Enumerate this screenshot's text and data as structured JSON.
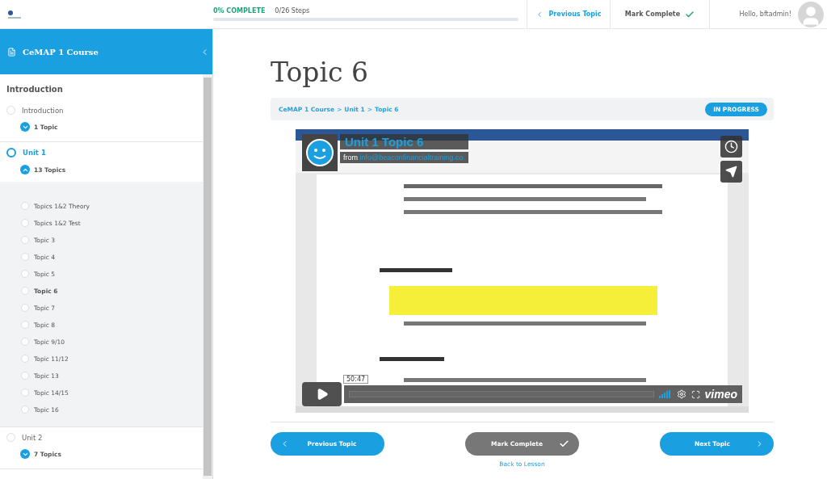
{
  "header": {
    "progress": {
      "label": "0% COMPLETE",
      "steps": "0/26 Steps",
      "level": 0
    },
    "nav": [
      {
        "kind": "previous",
        "label": "Previous Topic"
      },
      {
        "kind": "complete",
        "label": "Mark Complete"
      }
    ],
    "greeting": "Hello, bftadmin!"
  },
  "sidebar": {
    "course_title": "CeMAP 1 Course",
    "section_heading": "Introduction",
    "lessons": [
      {
        "title": "Introduction",
        "selected": false,
        "expanded": false,
        "topic_count": "1 Topic"
      },
      {
        "title": "Unit 1",
        "selected": true,
        "expanded": true,
        "topic_count": "13 Topics",
        "children": [
          {
            "title": "Topics 1&2 Theory",
            "selected": false
          },
          {
            "title": "Topics 1&2 Test",
            "selected": false
          },
          {
            "title": "Topic 3",
            "selected": false
          },
          {
            "title": "Topic 4",
            "selected": false
          },
          {
            "title": "Topic 5",
            "selected": false
          },
          {
            "title": "Topic 6",
            "selected": true
          },
          {
            "title": "Topic 7",
            "selected": false
          },
          {
            "title": "Topic 8",
            "selected": false
          },
          {
            "title": "Topic 9/10",
            "selected": false
          },
          {
            "title": "Topic 11/12",
            "selected": false
          },
          {
            "title": "Topic 13",
            "selected": false
          },
          {
            "title": "Topic 14/15",
            "selected": false
          },
          {
            "title": "Topic 16",
            "selected": false
          }
        ]
      },
      {
        "title": "Unit 2",
        "selected": false,
        "expanded": false,
        "topic_count": "7 Topics"
      }
    ]
  },
  "main": {
    "title": "Topic 6",
    "breadcrumb": {
      "items": [
        "CeMAP 1 Course",
        "Unit 1",
        "Topic 6"
      ],
      "separator": ">"
    },
    "status": "IN PROGRESS",
    "video": {
      "kind": "picture",
      "title": "Unit 1 Topic 6",
      "from": "from",
      "sender": "info@beaconfinancialtraining.co.",
      "time": "50:47",
      "brand": "vimeo"
    },
    "buttons": [
      {
        "kind": "previous",
        "label": "Previous Topic"
      },
      {
        "kind": "complete",
        "label": "Mark Complete"
      },
      {
        "kind": "next",
        "label": "Next Topic"
      }
    ],
    "back_link": "Back to Lesson"
  }
}
